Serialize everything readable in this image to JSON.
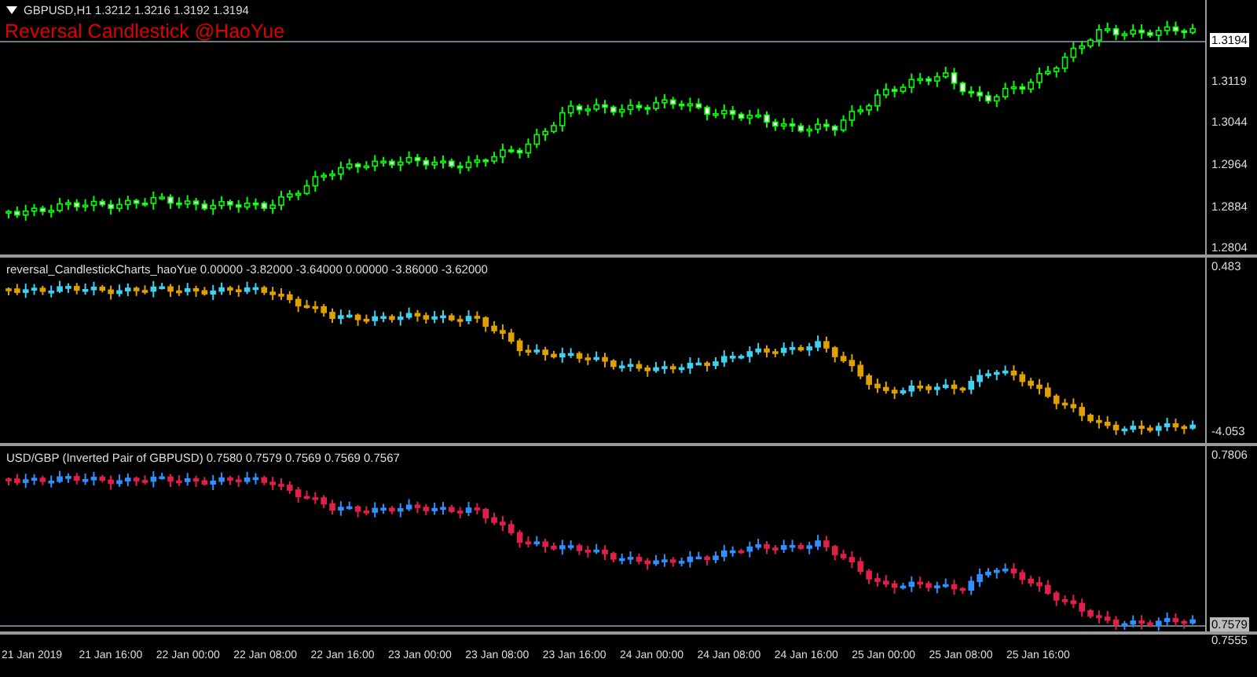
{
  "main_pane": {
    "symbol_caption": "GBPUSD,H1  1.3212 1.3216 1.3192 1.3194",
    "indicator_title": "Reversal Candlestick @HaoYue",
    "price_labels": [
      {
        "text": "1.3194",
        "kind": "current"
      },
      {
        "text": "1.3119",
        "kind": "tick"
      },
      {
        "text": "1.3044",
        "kind": "tick"
      },
      {
        "text": "1.2964",
        "kind": "tick"
      },
      {
        "text": "1.2884",
        "kind": "tick"
      },
      {
        "text": "1.2804",
        "kind": "tick"
      }
    ]
  },
  "indicator_pane": {
    "caption": "reversal_CandlestickCharts_haoYue 0.00000 -3.82000 -3.64000 0.00000 -3.86000 -3.62000",
    "price_labels": [
      {
        "text": "0.483"
      },
      {
        "text": "-4.053"
      }
    ]
  },
  "inverted_pane": {
    "caption": "USD/GBP (Inverted Pair of GBPUSD) 0.7580 0.7579 0.7569 0.7569 0.7567",
    "price_labels": [
      {
        "text": "0.7806",
        "kind": "tick"
      },
      {
        "text": "0.7579",
        "kind": "current"
      },
      {
        "text": "0.7555",
        "kind": "tick"
      }
    ]
  },
  "time_axis": [
    "21 Jan 2019",
    "21 Jan 16:00",
    "22 Jan 00:00",
    "22 Jan 08:00",
    "22 Jan 16:00",
    "23 Jan 00:00",
    "23 Jan 08:00",
    "23 Jan 16:00",
    "24 Jan 00:00",
    "24 Jan 08:00",
    "24 Jan 16:00",
    "25 Jan 00:00",
    "25 Jan 08:00",
    "25 Jan 16:00"
  ]
}
